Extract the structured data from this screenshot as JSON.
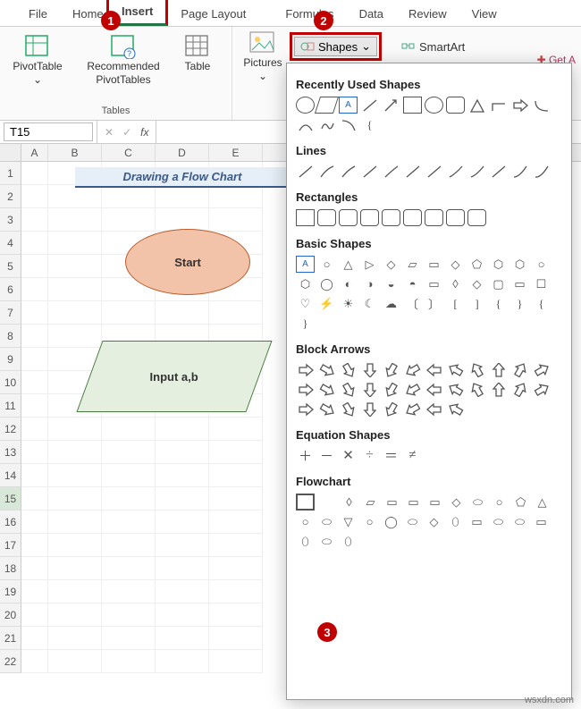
{
  "tabs": [
    "File",
    "Home",
    "Insert",
    "Page Layout",
    "Formulas",
    "Data",
    "Review",
    "View"
  ],
  "active_tab_index": 2,
  "ribbon": {
    "pivot": "PivotTable",
    "recpivot_l1": "Recommended",
    "recpivot_l2": "PivotTables",
    "table": "Table",
    "tables_group": "Tables",
    "pictures": "Pictures",
    "shapes_btn": "Shapes",
    "smartart": "SmartArt",
    "geta": "Get A"
  },
  "namebox": "T15",
  "fx": "fx",
  "columns": [
    "A",
    "B",
    "C",
    "D",
    "E"
  ],
  "rows": [
    "1",
    "2",
    "3",
    "4",
    "5",
    "6",
    "7",
    "8",
    "9",
    "10",
    "11",
    "12",
    "13",
    "14",
    "15",
    "16",
    "17",
    "18",
    "19",
    "20",
    "21",
    "22"
  ],
  "sheet": {
    "title": "Drawing a Flow Chart",
    "start": "Start",
    "input": "Input a,b"
  },
  "panel": {
    "recent": "Recently Used Shapes",
    "lines": "Lines",
    "rect": "Rectangles",
    "basic": "Basic Shapes",
    "block": "Block Arrows",
    "eq": "Equation Shapes",
    "flow": "Flowchart"
  },
  "callouts": {
    "c1": "1",
    "c2": "2",
    "c3": "3"
  },
  "watermark": "wsxdn.com"
}
